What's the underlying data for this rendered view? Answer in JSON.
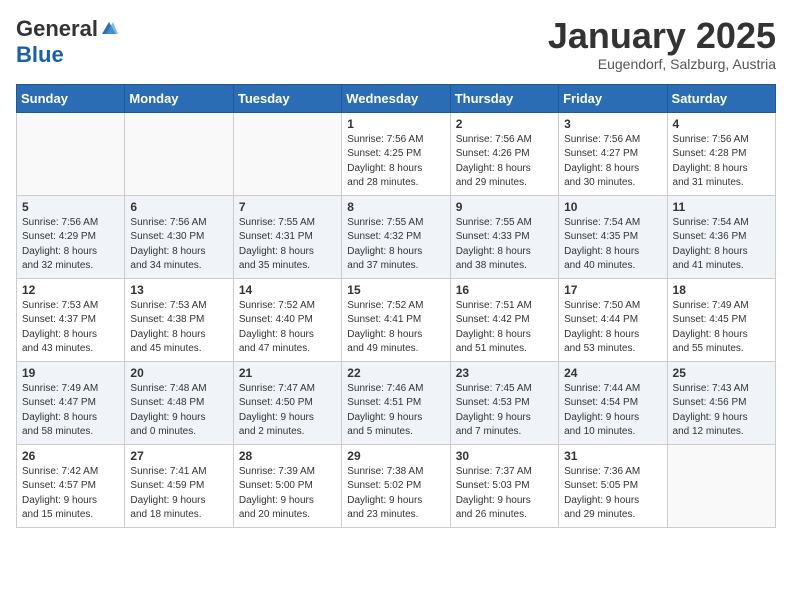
{
  "logo": {
    "general": "General",
    "blue": "Blue"
  },
  "header": {
    "month": "January 2025",
    "location": "Eugendorf, Salzburg, Austria"
  },
  "weekdays": [
    "Sunday",
    "Monday",
    "Tuesday",
    "Wednesday",
    "Thursday",
    "Friday",
    "Saturday"
  ],
  "weeks": [
    [
      {
        "day": "",
        "info": ""
      },
      {
        "day": "",
        "info": ""
      },
      {
        "day": "",
        "info": ""
      },
      {
        "day": "1",
        "info": "Sunrise: 7:56 AM\nSunset: 4:25 PM\nDaylight: 8 hours\nand 28 minutes."
      },
      {
        "day": "2",
        "info": "Sunrise: 7:56 AM\nSunset: 4:26 PM\nDaylight: 8 hours\nand 29 minutes."
      },
      {
        "day": "3",
        "info": "Sunrise: 7:56 AM\nSunset: 4:27 PM\nDaylight: 8 hours\nand 30 minutes."
      },
      {
        "day": "4",
        "info": "Sunrise: 7:56 AM\nSunset: 4:28 PM\nDaylight: 8 hours\nand 31 minutes."
      }
    ],
    [
      {
        "day": "5",
        "info": "Sunrise: 7:56 AM\nSunset: 4:29 PM\nDaylight: 8 hours\nand 32 minutes."
      },
      {
        "day": "6",
        "info": "Sunrise: 7:56 AM\nSunset: 4:30 PM\nDaylight: 8 hours\nand 34 minutes."
      },
      {
        "day": "7",
        "info": "Sunrise: 7:55 AM\nSunset: 4:31 PM\nDaylight: 8 hours\nand 35 minutes."
      },
      {
        "day": "8",
        "info": "Sunrise: 7:55 AM\nSunset: 4:32 PM\nDaylight: 8 hours\nand 37 minutes."
      },
      {
        "day": "9",
        "info": "Sunrise: 7:55 AM\nSunset: 4:33 PM\nDaylight: 8 hours\nand 38 minutes."
      },
      {
        "day": "10",
        "info": "Sunrise: 7:54 AM\nSunset: 4:35 PM\nDaylight: 8 hours\nand 40 minutes."
      },
      {
        "day": "11",
        "info": "Sunrise: 7:54 AM\nSunset: 4:36 PM\nDaylight: 8 hours\nand 41 minutes."
      }
    ],
    [
      {
        "day": "12",
        "info": "Sunrise: 7:53 AM\nSunset: 4:37 PM\nDaylight: 8 hours\nand 43 minutes."
      },
      {
        "day": "13",
        "info": "Sunrise: 7:53 AM\nSunset: 4:38 PM\nDaylight: 8 hours\nand 45 minutes."
      },
      {
        "day": "14",
        "info": "Sunrise: 7:52 AM\nSunset: 4:40 PM\nDaylight: 8 hours\nand 47 minutes."
      },
      {
        "day": "15",
        "info": "Sunrise: 7:52 AM\nSunset: 4:41 PM\nDaylight: 8 hours\nand 49 minutes."
      },
      {
        "day": "16",
        "info": "Sunrise: 7:51 AM\nSunset: 4:42 PM\nDaylight: 8 hours\nand 51 minutes."
      },
      {
        "day": "17",
        "info": "Sunrise: 7:50 AM\nSunset: 4:44 PM\nDaylight: 8 hours\nand 53 minutes."
      },
      {
        "day": "18",
        "info": "Sunrise: 7:49 AM\nSunset: 4:45 PM\nDaylight: 8 hours\nand 55 minutes."
      }
    ],
    [
      {
        "day": "19",
        "info": "Sunrise: 7:49 AM\nSunset: 4:47 PM\nDaylight: 8 hours\nand 58 minutes."
      },
      {
        "day": "20",
        "info": "Sunrise: 7:48 AM\nSunset: 4:48 PM\nDaylight: 9 hours\nand 0 minutes."
      },
      {
        "day": "21",
        "info": "Sunrise: 7:47 AM\nSunset: 4:50 PM\nDaylight: 9 hours\nand 2 minutes."
      },
      {
        "day": "22",
        "info": "Sunrise: 7:46 AM\nSunset: 4:51 PM\nDaylight: 9 hours\nand 5 minutes."
      },
      {
        "day": "23",
        "info": "Sunrise: 7:45 AM\nSunset: 4:53 PM\nDaylight: 9 hours\nand 7 minutes."
      },
      {
        "day": "24",
        "info": "Sunrise: 7:44 AM\nSunset: 4:54 PM\nDaylight: 9 hours\nand 10 minutes."
      },
      {
        "day": "25",
        "info": "Sunrise: 7:43 AM\nSunset: 4:56 PM\nDaylight: 9 hours\nand 12 minutes."
      }
    ],
    [
      {
        "day": "26",
        "info": "Sunrise: 7:42 AM\nSunset: 4:57 PM\nDaylight: 9 hours\nand 15 minutes."
      },
      {
        "day": "27",
        "info": "Sunrise: 7:41 AM\nSunset: 4:59 PM\nDaylight: 9 hours\nand 18 minutes."
      },
      {
        "day": "28",
        "info": "Sunrise: 7:39 AM\nSunset: 5:00 PM\nDaylight: 9 hours\nand 20 minutes."
      },
      {
        "day": "29",
        "info": "Sunrise: 7:38 AM\nSunset: 5:02 PM\nDaylight: 9 hours\nand 23 minutes."
      },
      {
        "day": "30",
        "info": "Sunrise: 7:37 AM\nSunset: 5:03 PM\nDaylight: 9 hours\nand 26 minutes."
      },
      {
        "day": "31",
        "info": "Sunrise: 7:36 AM\nSunset: 5:05 PM\nDaylight: 9 hours\nand 29 minutes."
      },
      {
        "day": "",
        "info": ""
      }
    ]
  ]
}
